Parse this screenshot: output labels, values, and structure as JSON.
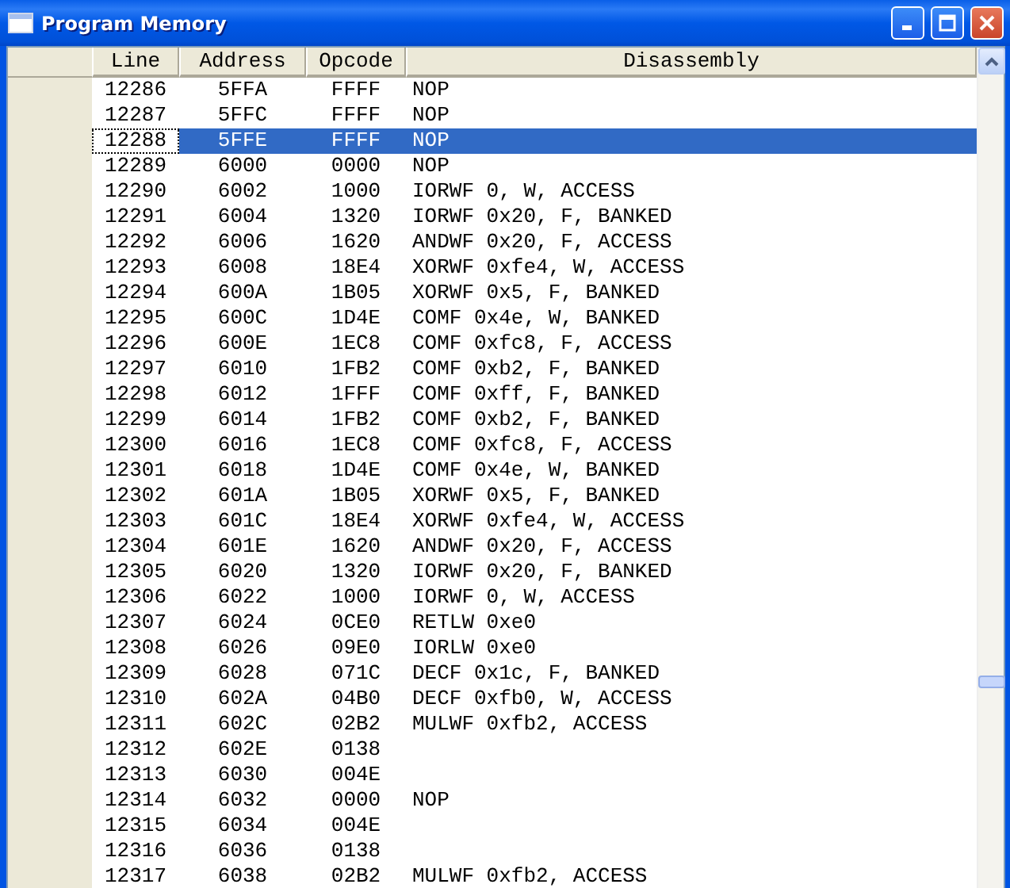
{
  "window": {
    "title": "Program Memory"
  },
  "table": {
    "columns": [
      "Line",
      "Address",
      "Opcode",
      "Disassembly"
    ],
    "rows": [
      {
        "line": "12286",
        "address": "5FFA",
        "opcode": "FFFF",
        "disassembly": "NOP",
        "selected": false
      },
      {
        "line": "12287",
        "address": "5FFC",
        "opcode": "FFFF",
        "disassembly": "NOP",
        "selected": false
      },
      {
        "line": "12288",
        "address": "5FFE",
        "opcode": "FFFF",
        "disassembly": "NOP",
        "selected": true
      },
      {
        "line": "12289",
        "address": "6000",
        "opcode": "0000",
        "disassembly": "NOP",
        "selected": false
      },
      {
        "line": "12290",
        "address": "6002",
        "opcode": "1000",
        "disassembly": "IORWF 0, W, ACCESS",
        "selected": false
      },
      {
        "line": "12291",
        "address": "6004",
        "opcode": "1320",
        "disassembly": "IORWF 0x20, F, BANKED",
        "selected": false
      },
      {
        "line": "12292",
        "address": "6006",
        "opcode": "1620",
        "disassembly": "ANDWF 0x20, F, ACCESS",
        "selected": false
      },
      {
        "line": "12293",
        "address": "6008",
        "opcode": "18E4",
        "disassembly": "XORWF 0xfe4, W, ACCESS",
        "selected": false
      },
      {
        "line": "12294",
        "address": "600A",
        "opcode": "1B05",
        "disassembly": "XORWF 0x5, F, BANKED",
        "selected": false
      },
      {
        "line": "12295",
        "address": "600C",
        "opcode": "1D4E",
        "disassembly": "COMF 0x4e, W, BANKED",
        "selected": false
      },
      {
        "line": "12296",
        "address": "600E",
        "opcode": "1EC8",
        "disassembly": "COMF 0xfc8, F, ACCESS",
        "selected": false
      },
      {
        "line": "12297",
        "address": "6010",
        "opcode": "1FB2",
        "disassembly": "COMF 0xb2, F, BANKED",
        "selected": false
      },
      {
        "line": "12298",
        "address": "6012",
        "opcode": "1FFF",
        "disassembly": "COMF 0xff, F, BANKED",
        "selected": false
      },
      {
        "line": "12299",
        "address": "6014",
        "opcode": "1FB2",
        "disassembly": "COMF 0xb2, F, BANKED",
        "selected": false
      },
      {
        "line": "12300",
        "address": "6016",
        "opcode": "1EC8",
        "disassembly": "COMF 0xfc8, F, ACCESS",
        "selected": false
      },
      {
        "line": "12301",
        "address": "6018",
        "opcode": "1D4E",
        "disassembly": "COMF 0x4e, W, BANKED",
        "selected": false
      },
      {
        "line": "12302",
        "address": "601A",
        "opcode": "1B05",
        "disassembly": "XORWF 0x5, F, BANKED",
        "selected": false
      },
      {
        "line": "12303",
        "address": "601C",
        "opcode": "18E4",
        "disassembly": "XORWF 0xfe4, W, ACCESS",
        "selected": false
      },
      {
        "line": "12304",
        "address": "601E",
        "opcode": "1620",
        "disassembly": "ANDWF 0x20, F, ACCESS",
        "selected": false
      },
      {
        "line": "12305",
        "address": "6020",
        "opcode": "1320",
        "disassembly": "IORWF 0x20, F, BANKED",
        "selected": false
      },
      {
        "line": "12306",
        "address": "6022",
        "opcode": "1000",
        "disassembly": "IORWF 0, W, ACCESS",
        "selected": false
      },
      {
        "line": "12307",
        "address": "6024",
        "opcode": "0CE0",
        "disassembly": "RETLW 0xe0",
        "selected": false
      },
      {
        "line": "12308",
        "address": "6026",
        "opcode": "09E0",
        "disassembly": "IORLW 0xe0",
        "selected": false
      },
      {
        "line": "12309",
        "address": "6028",
        "opcode": "071C",
        "disassembly": "DECF 0x1c, F, BANKED",
        "selected": false
      },
      {
        "line": "12310",
        "address": "602A",
        "opcode": "04B0",
        "disassembly": "DECF 0xfb0, W, ACCESS",
        "selected": false
      },
      {
        "line": "12311",
        "address": "602C",
        "opcode": "02B2",
        "disassembly": "MULWF 0xfb2, ACCESS",
        "selected": false
      },
      {
        "line": "12312",
        "address": "602E",
        "opcode": "0138",
        "selected": false
      },
      {
        "line": "12313",
        "address": "6030",
        "opcode": "004E",
        "selected": false
      },
      {
        "line": "12314",
        "address": "6032",
        "opcode": "0000",
        "disassembly": "NOP",
        "selected": false
      },
      {
        "line": "12315",
        "address": "6034",
        "opcode": "004E",
        "selected": false
      },
      {
        "line": "12316",
        "address": "6036",
        "opcode": "0138",
        "selected": false
      },
      {
        "line": "12317",
        "address": "6038",
        "opcode": "02B2",
        "disassembly": "MULWF 0xfb2, ACCESS",
        "selected": false
      }
    ]
  }
}
